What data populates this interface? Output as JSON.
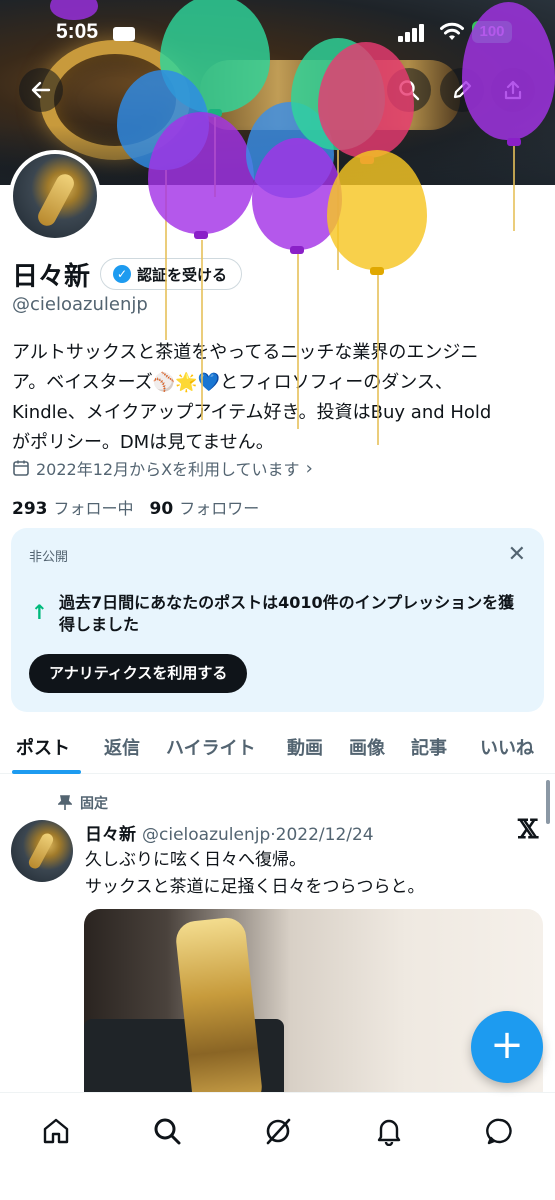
{
  "status_bar": {
    "time": "5:05",
    "battery": "100"
  },
  "header": {
    "back_icon": "arrow-left-icon",
    "actions": [
      "search-icon",
      "edit-pencil-icon",
      "share-icon"
    ]
  },
  "profile": {
    "display_name": "日々新",
    "verify_button": "認証を受ける",
    "handle": "@cieloazulenjp",
    "bio_lines": [
      "アルトサックスと茶道をやってるニッチな業界のエンジニ",
      "ア。ベイスターズ⚾🌟💙とフィロソフィーのダンス、",
      "Kindle、メイクアップアイテム好き。投資はBuy and Hold",
      "がポリシー。DMは見てません。"
    ],
    "joined": "2022年12月からXを利用しています",
    "following_count": "293",
    "following_label": "フォロー中",
    "followers_count": "90",
    "followers_label": "フォロワー"
  },
  "impressions_card": {
    "private_label": "非公開",
    "message": "過去7日間にあなたのポストは4010件のインプレッションを獲得しました",
    "button": "アナリティクスを利用する"
  },
  "tabs": [
    "ポスト",
    "返信",
    "ハイライト",
    "動画",
    "画像",
    "記事",
    "いいね"
  ],
  "active_tab": "ポスト",
  "pinned_post": {
    "pinned_label": "固定",
    "author": "日々新",
    "handle_date": "@cieloazulenjp·2022/12/24",
    "text_lines": [
      "久しぶりに呟く日々へ復帰。",
      "サックスと茶道に足掻く日々をつらつらと。"
    ]
  },
  "fab": {
    "label": "+"
  },
  "bottom_nav": [
    "home-icon",
    "search-icon",
    "grok-icon",
    "notifications-bell-icon",
    "messages-icon"
  ],
  "colors": {
    "accent": "#1d9bf0",
    "text_primary": "#0f1419",
    "text_secondary": "#536471",
    "card_bg": "#e8f5fd",
    "impression_arrow": "#00ba7c"
  }
}
